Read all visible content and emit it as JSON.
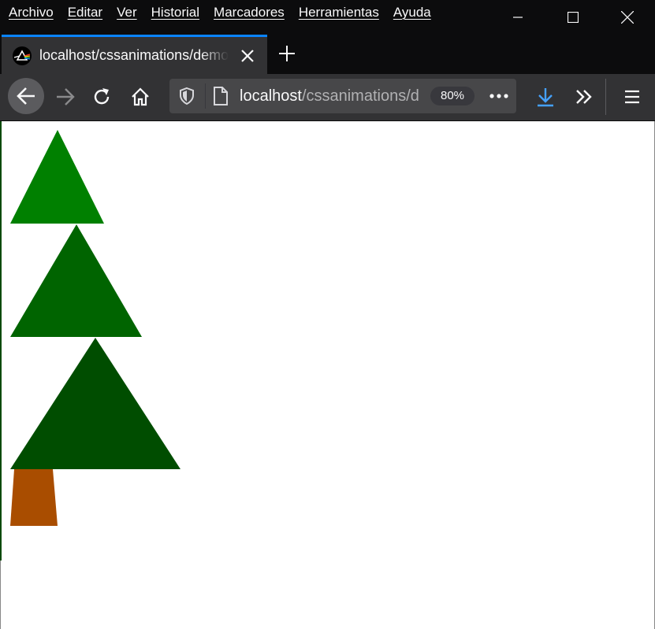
{
  "menubar": {
    "items": [
      "Archivo",
      "Editar",
      "Ver",
      "Historial",
      "Marcadores",
      "Herramientas",
      "Ayuda"
    ]
  },
  "tab": {
    "title": "localhost/cssanimations/demo.html"
  },
  "urlbar": {
    "host": "localhost",
    "path": "/cssanimations/demo.html",
    "zoom": "80%"
  },
  "icons": {
    "minimize": "minimize-icon",
    "maximize": "maximize-icon",
    "close": "close-icon",
    "back": "back-arrow-icon",
    "forward": "forward-arrow-icon",
    "reload": "reload-icon",
    "home": "home-icon",
    "shield": "shield-icon",
    "page": "page-icon",
    "more": "more-dots-icon",
    "download": "download-icon",
    "overflow": "chevron-double-right-icon",
    "menu": "hamburger-menu-icon"
  },
  "colors": {
    "tree_top": "#008000",
    "tree_middle": "#006400",
    "tree_bottom": "#004d00",
    "trunk": "#a94d00",
    "accent": "#0a84ff"
  }
}
